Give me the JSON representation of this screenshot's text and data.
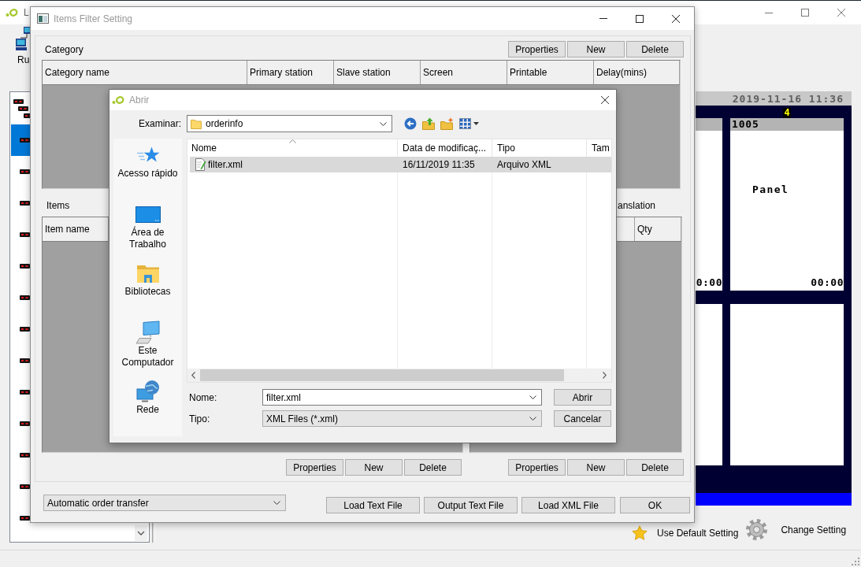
{
  "background_window": {
    "title": "L",
    "toolbar": [
      {
        "label": "Ru"
      }
    ],
    "device_list": {
      "items": [
        {
          "kind": "group",
          "selected": false
        },
        {
          "kind": "device",
          "selected": true
        },
        {
          "kind": "device",
          "selected": false
        },
        {
          "kind": "device",
          "selected": false
        },
        {
          "kind": "device",
          "selected": false
        },
        {
          "kind": "device",
          "selected": false
        },
        {
          "kind": "device",
          "selected": false
        },
        {
          "kind": "device",
          "selected": false
        },
        {
          "kind": "device",
          "selected": false
        },
        {
          "kind": "device",
          "selected": false
        },
        {
          "kind": "device",
          "selected": false
        },
        {
          "kind": "device",
          "selected": false
        },
        {
          "kind": "device",
          "selected": false
        },
        {
          "kind": "device",
          "selected": false
        }
      ]
    },
    "display_panel": {
      "clock": "2019-11-16 11:36",
      "page": "4",
      "tiles": [
        {
          "kind": "order",
          "time": "0:00"
        },
        {
          "kind": "order",
          "number": "1005",
          "label": "Panel",
          "time": "00:00"
        },
        {
          "kind": "empty"
        },
        {
          "kind": "empty"
        }
      ]
    },
    "actions": [
      {
        "kind": "star",
        "label": "Use Default Setting"
      },
      {
        "kind": "gear",
        "label": "Change Setting"
      }
    ]
  },
  "filter_window": {
    "title": "Items Filter Setting",
    "category": {
      "label": "Category",
      "buttons": [
        "Properties",
        "New",
        "Delete"
      ],
      "columns": [
        "Category name",
        "Primary station",
        "Slave station",
        "Screen",
        "Printable",
        "Delay(mins)"
      ]
    },
    "items": {
      "label": "Items",
      "columns": [
        "Item name"
      ],
      "buttons": [
        "Properties",
        "New",
        "Delete"
      ]
    },
    "translation": {
      "label": "anslation",
      "columns": [
        "Qty"
      ],
      "buttons": [
        "Properties",
        "New",
        "Delete"
      ]
    },
    "order_mode": {
      "value": "Automatic order transfer"
    },
    "buttons": [
      "Load Text File",
      "Output Text File",
      "Load XML File",
      "OK"
    ]
  },
  "open_dialog": {
    "title": "Abrir",
    "look_in": {
      "label": "Examinar:",
      "value": "orderinfo"
    },
    "places": [
      {
        "kind": "quick_access",
        "label": "Acesso rápido"
      },
      {
        "kind": "desktop",
        "label": "Área de Trabalho"
      },
      {
        "kind": "libraries",
        "label": "Bibliotecas"
      },
      {
        "kind": "computer",
        "label": "Este Computador"
      },
      {
        "kind": "network",
        "label": "Rede"
      }
    ],
    "file_list": {
      "columns": [
        {
          "label": "Nome",
          "sorted": true
        },
        {
          "label": "Data de modificaç...",
          "sorted": false
        },
        {
          "label": "Tipo",
          "sorted": false
        },
        {
          "label": "Tam",
          "sorted": false
        }
      ],
      "rows": [
        {
          "cells": [
            "filter.xml",
            "16/11/2019 11:35",
            "Arquivo XML"
          ],
          "selected": true
        }
      ]
    },
    "file_name": {
      "label": "Nome:",
      "value": "filter.xml"
    },
    "file_type": {
      "label": "Tipo:",
      "value": "XML Files (*.xml)"
    },
    "buttons": [
      "Abrir",
      "Cancelar"
    ]
  }
}
